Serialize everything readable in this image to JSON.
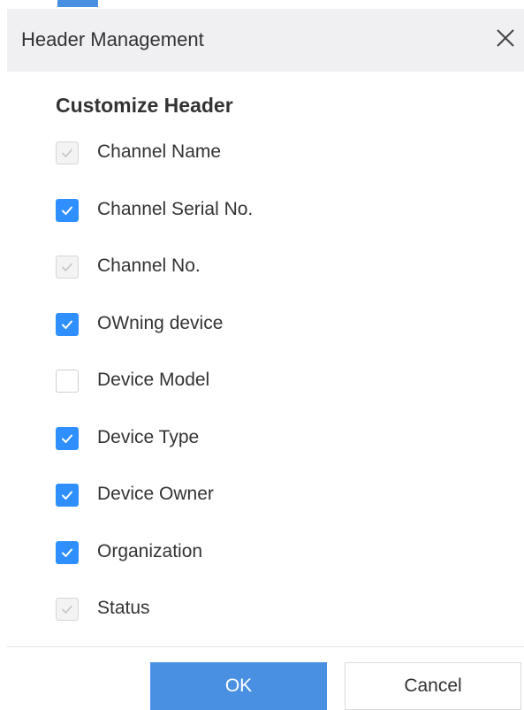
{
  "dialog": {
    "title": "Header Management",
    "close_icon": "close-icon"
  },
  "section": {
    "title": "Customize Header"
  },
  "options": [
    {
      "label": "Channel Name",
      "checked": true,
      "disabled": true
    },
    {
      "label": "Channel Serial No.",
      "checked": true,
      "disabled": false
    },
    {
      "label": "Channel No.",
      "checked": true,
      "disabled": true
    },
    {
      "label": "OWning device",
      "checked": true,
      "disabled": false
    },
    {
      "label": "Device Model",
      "checked": false,
      "disabled": false
    },
    {
      "label": "Device Type",
      "checked": true,
      "disabled": false
    },
    {
      "label": "Device Owner",
      "checked": true,
      "disabled": false
    },
    {
      "label": "Organization",
      "checked": true,
      "disabled": false
    },
    {
      "label": "Status",
      "checked": true,
      "disabled": true
    }
  ],
  "footer": {
    "ok_label": "OK",
    "cancel_label": "Cancel"
  },
  "colors": {
    "accent": "#4a90e2",
    "checkbox_checked": "#2f8fff",
    "header_bg": "#f0eff2",
    "text": "#333333"
  }
}
